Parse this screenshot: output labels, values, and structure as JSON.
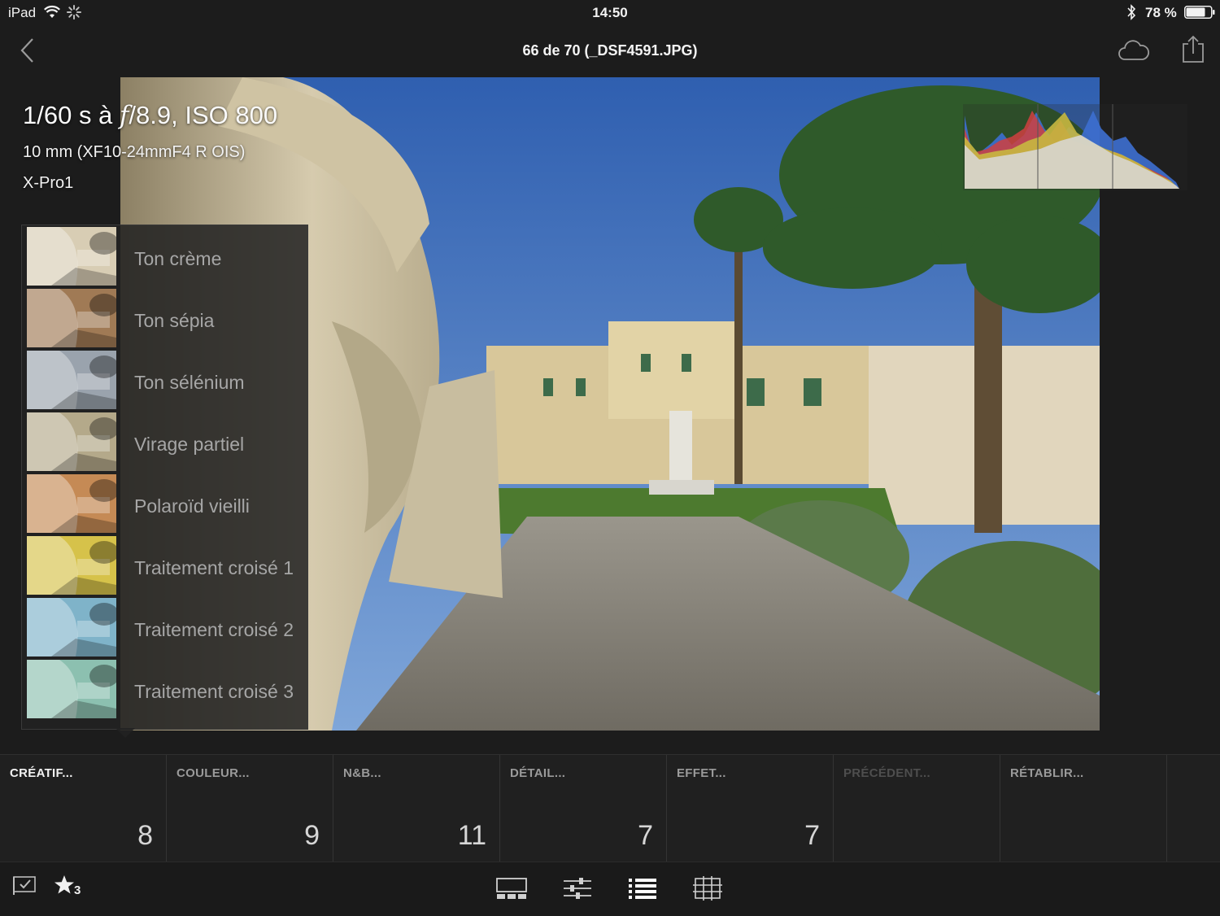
{
  "status_bar": {
    "device": "iPad",
    "time": "14:50",
    "battery": "78 %",
    "battery_level": 0.78
  },
  "nav": {
    "title": "66 de 70 (_DSF4591.JPG)"
  },
  "exif": {
    "shutter_prefix": "1/60 s à ",
    "aperture_f": "f",
    "aperture_rest": "/8.9, ISO 800",
    "lens": "10 mm (XF10-24mmF4 R OIS)",
    "camera": "X-Pro1"
  },
  "presets": [
    {
      "label": "Ton crème",
      "tint": "#d8cdb4"
    },
    {
      "label": "Ton sépia",
      "tint": "#a07a55"
    },
    {
      "label": "Ton sélénium",
      "tint": "#9aa3ad"
    },
    {
      "label": "Virage partiel",
      "tint": "#b4a98a"
    },
    {
      "label": "Polaroïd vieilli",
      "tint": "#c58a55"
    },
    {
      "label": "Traitement croisé 1",
      "tint": "#d6c24a"
    },
    {
      "label": "Traitement croisé 2",
      "tint": "#7fb3c9"
    },
    {
      "label": "Traitement croisé 3",
      "tint": "#8cc0b0"
    }
  ],
  "categories": [
    {
      "label": "CRÉATIF...",
      "count": "8",
      "state": "active"
    },
    {
      "label": "COULEUR...",
      "count": "9",
      "state": "normal"
    },
    {
      "label": "N&B...",
      "count": "11",
      "state": "normal"
    },
    {
      "label": "DÉTAIL...",
      "count": "7",
      "state": "normal"
    },
    {
      "label": "EFFET...",
      "count": "7",
      "state": "normal"
    },
    {
      "label": "PRÉCÉDENT...",
      "count": "",
      "state": "disabled"
    },
    {
      "label": "RÉTABLIR...",
      "count": "",
      "state": "normal"
    }
  ],
  "toolbar": {
    "rating": "3",
    "icons": [
      "flag-icon",
      "star-icon",
      "filmstrip-icon",
      "adjust-sliders-icon",
      "presets-list-icon",
      "crop-grid-icon"
    ]
  },
  "colors": {
    "background": "#1c1c1c",
    "panel": "#222222",
    "active_text": "#f2f2f2",
    "inactive_text": "#9a9a9a",
    "disabled_text": "#4e4e4e"
  }
}
